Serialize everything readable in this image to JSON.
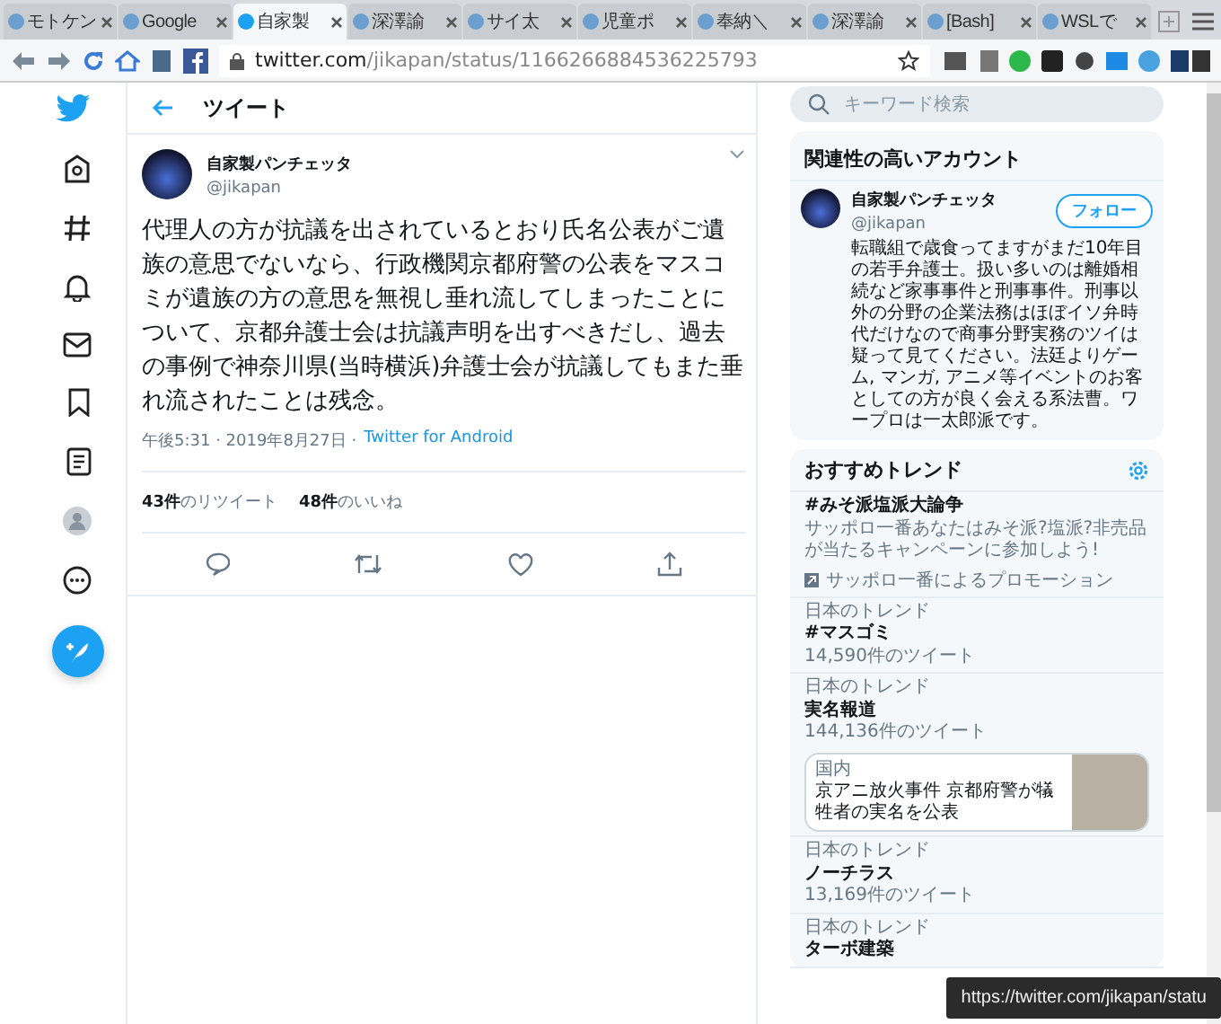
{
  "browser": {
    "tabs": [
      {
        "label": "モトケン",
        "selected": false
      },
      {
        "label": "Google",
        "selected": false
      },
      {
        "label": "自家製",
        "selected": true
      },
      {
        "label": "深澤諭",
        "selected": false
      },
      {
        "label": "サイ太",
        "selected": false
      },
      {
        "label": "児童ポ",
        "selected": false
      },
      {
        "label": "奉納＼",
        "selected": false
      },
      {
        "label": "深澤諭",
        "selected": false
      },
      {
        "label": "[Bash]",
        "selected": false
      },
      {
        "label": "WSLで",
        "selected": false
      }
    ],
    "url": {
      "host": "twitter.com",
      "path": "/jikapan/status/1166266884536225793"
    }
  },
  "header": {
    "title": "ツイート"
  },
  "tweet": {
    "name": "自家製パンチェッタ",
    "handle": "@jikapan",
    "text": "代理人の方が抗議を出されているとおり氏名公表がご遺族の意思でないなら、行政機関京都府警の公表をマスコミが遺族の方の意思を無視し垂れ流してしまったことについて、京都弁護士会は抗議声明を出すべきだし、過去の事例で神奈川県(当時横浜)弁護士会が抗議してもまた垂れ流されたことは残念。",
    "time": "午後5:31 · 2019年8月27日 ·",
    "source": "Twitter for Android",
    "stats": [
      {
        "count": "43件",
        "label": "のリツイート"
      },
      {
        "count": "48件",
        "label": "のいいね"
      }
    ]
  },
  "sidebar": {
    "search": {
      "placeholder": "キーワード検索"
    },
    "related": {
      "title": "関連性の高いアカウント",
      "account": {
        "name": "自家製パンチェッタ",
        "handle": "@jikapan",
        "follow": "フォロー",
        "bio": "転職組で歳食ってますがまだ10年目の若手弁護士。扱い多いのは離婚相続など家事事件と刑事事件。刑事以外の分野の企業法務はほぼイソ弁時代だけなので商事分野実務のツイは疑って見てください。法廷よりゲーム, マンガ, アニメ等イベントのお客としての方が良く会える系法曹。ワープロは一太郎派です。"
      }
    },
    "trends": {
      "title": "おすすめトレンド",
      "items": [
        {
          "kind": "promoted",
          "name": "#みそ派塩派大論争",
          "description": "サッポロ一番あなたはみそ派?塩派?非売品が当たるキャンペーンに参加しよう!",
          "promoter": "サッポロ一番によるプロモーション"
        },
        {
          "kind": "trend",
          "context": "日本のトレンド",
          "name": "#マスゴミ",
          "count": "14,590件のツイート"
        },
        {
          "kind": "trend",
          "context": "日本のトレンド",
          "name": "実名報道",
          "count": "144,136件のツイート",
          "news": {
            "category": "国内",
            "headline": "京アニ放火事件 京都府警が犠牲者の実名を公表"
          }
        },
        {
          "kind": "trend",
          "context": "日本のトレンド",
          "name": "ノーチラス",
          "count": "13,169件のツイート"
        },
        {
          "kind": "trend",
          "context": "日本のトレンド",
          "name": "ターボ建築"
        }
      ]
    }
  },
  "status_tooltip": "https://twitter.com/jikapan/statu"
}
